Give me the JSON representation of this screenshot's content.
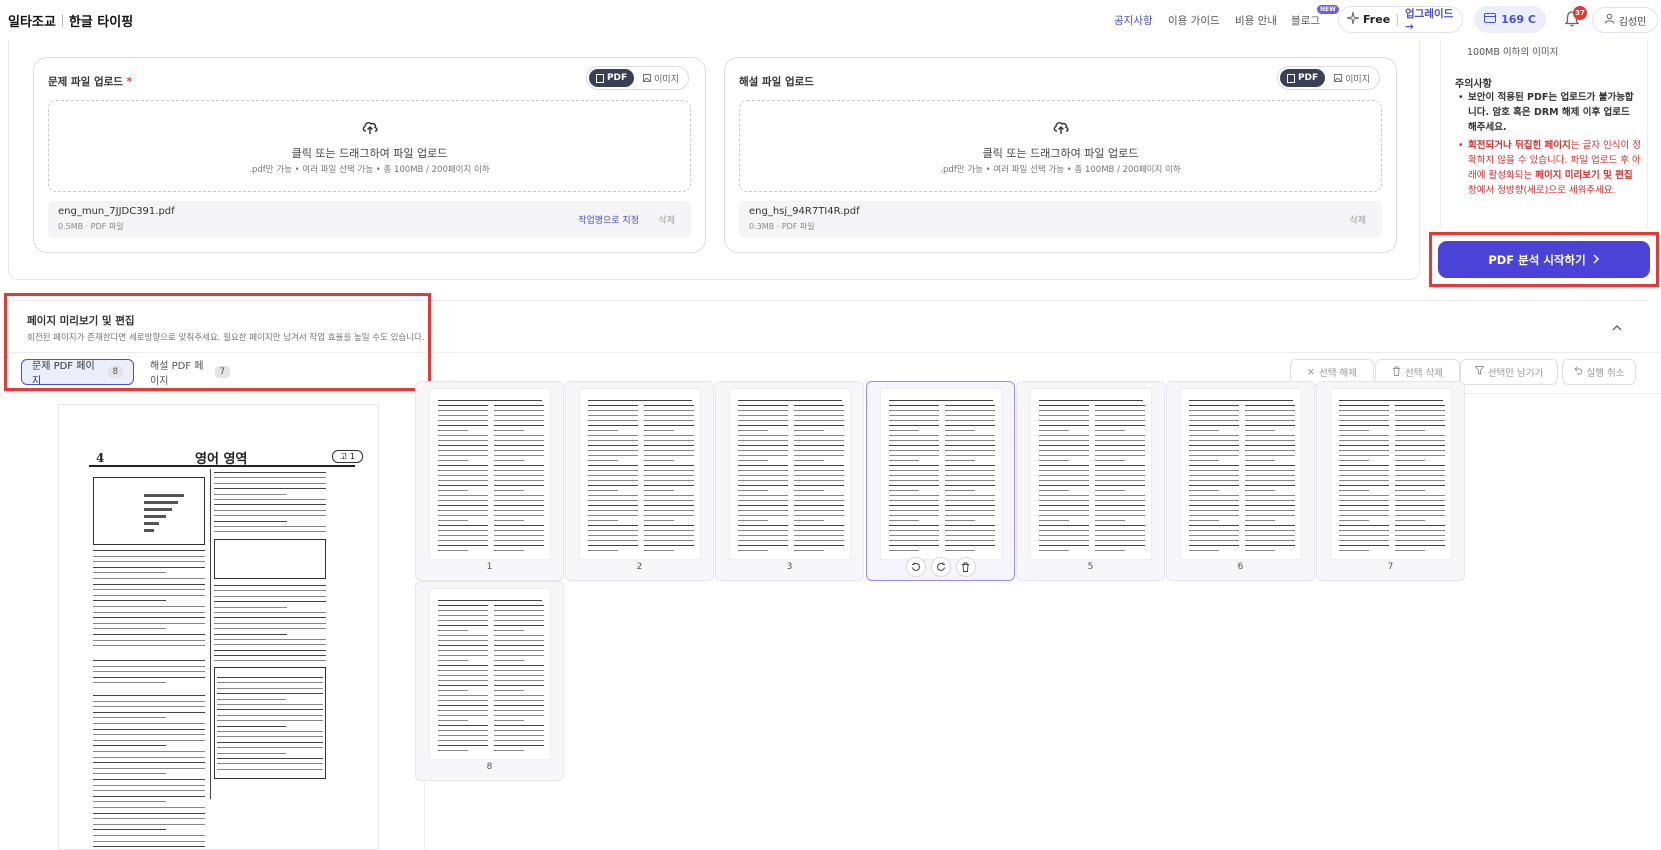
{
  "brand": {
    "name1": "일타조교",
    "name2": "한글 타이핑"
  },
  "nav": {
    "links": [
      "공지사항",
      "이용 가이드",
      "비용 안내",
      "블로그"
    ],
    "new_badge": "NEW",
    "plan": "Free",
    "upgrade": "업그레이드 →",
    "credits": "169 C",
    "notif_count": "37",
    "user": "김성민"
  },
  "upload": {
    "problem": {
      "title": "문제 파일 업로드",
      "required": "*",
      "seg_pdf": "PDF",
      "seg_image": "이미지",
      "drop_text": "클릭 또는 드래그하여 파일 업로드",
      "drop_hint": ".pdf만 가능 • 여러 파일 선택 가능 • 총 100MB / 200페이지 이하",
      "file_name": "eng_mun_7JJDC391.pdf",
      "file_meta": "0.5MB · PDF 파일",
      "set_name": "작업명으로 지정",
      "delete": "삭제"
    },
    "solution": {
      "title": "해설 파일 업로드",
      "seg_pdf": "PDF",
      "seg_image": "이미지",
      "drop_text": "클릭 또는 드래그하여 파일 업로드",
      "drop_hint": ".pdf만 가능 • 여러 파일 선택 가능 • 총 100MB / 200페이지 이하",
      "file_name": "eng_hsj_94R7TI4R.pdf",
      "file_meta": "0.3MB · PDF 파일",
      "delete": "삭제"
    }
  },
  "side": {
    "size_limit": "100MB 이하의 이미지",
    "notice_title": "주의사항",
    "notice1_a": "보안이 적용된 PDF는 업로드가 불가능합니다. 암호 혹은 DRM 해제 이후 업로드 해주세요.",
    "notice2_b1": "회전되거나 뒤집힌 페이지",
    "notice2_t1": "는 글자 인식이 정확하지 않을 수 있습니다. 파일 업로드 후 아래에 활성화되는 ",
    "notice2_b2": "페이지 미리보기 및 편집",
    "notice2_t2": " 창에서 정방향(세로)으로 세워주세요.",
    "start_button": "PDF 분석 시작하기"
  },
  "preview": {
    "title": "페이지 미리보기 및 편집",
    "subtitle": "회전된 페이지가 존재한다면 세로방향으로 맞춰주세요. 필요한 페이지만 남겨서 작업 효율을 높일 수도 있습니다.",
    "tabs": [
      {
        "label": "문제 PDF 페이지",
        "count": "8"
      },
      {
        "label": "해설 PDF 페이지",
        "count": "7"
      }
    ],
    "toolbar": {
      "deselect": "선택 해제",
      "delete_sel": "선택 삭제",
      "keep_sel": "선택만 남기기",
      "undo": "실행 취소"
    },
    "big_page": {
      "page_no": "4",
      "section": "영어 영역",
      "grade": "고 1"
    },
    "pages": [
      "1",
      "2",
      "3",
      "4",
      "5",
      "6",
      "7",
      "8"
    ],
    "selected_page": "4"
  }
}
